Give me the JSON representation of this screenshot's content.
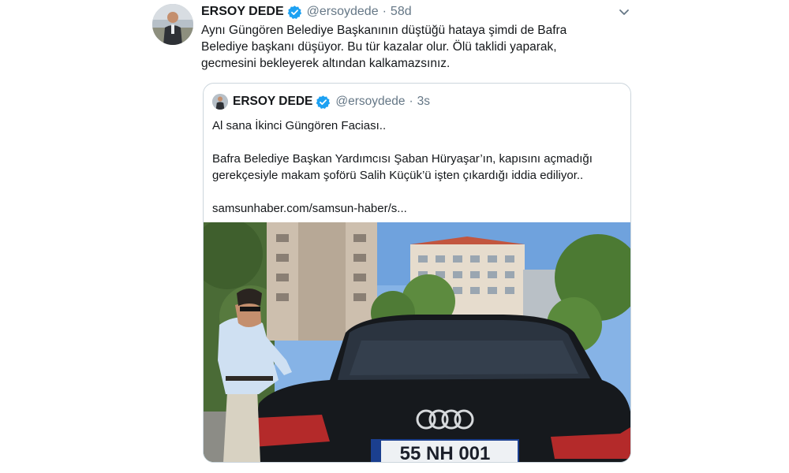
{
  "tweet": {
    "author_name": "ERSOY DEDE",
    "handle": "@ersoydede",
    "separator": "·",
    "time": "58d",
    "text_lines": [
      "Aynı Güngören Belediye Başkanının düştüğü hataya şimdi de Bafra",
      "Belediye başkanı düşüyor. Bu tür kazalar olur. Ölü taklidi yaparak,",
      "gecmesini bekleyerek altından kalkamazsınız."
    ]
  },
  "quote": {
    "author_name": "ERSOY DEDE",
    "handle": "@ersoydede",
    "separator": "·",
    "time": "3s",
    "line1": "Al sana İkinci Güngören Faciası..",
    "line2": "Bafra Belediye Başkan Yardımcısı Şaban Hüryaşar’ın, kapısını açmadığı",
    "line3": "gerekçesiyle makam şoförü Salih Küçük’ü işten çıkardığı iddia ediliyor..",
    "link": "samsunhaber.com/samsun-haber/s...",
    "image": {
      "plate_text": "55 NH 001"
    }
  },
  "colors": {
    "text": "#14171a",
    "secondary": "#657786",
    "verified": "#1da1f2",
    "border": "#ccd6dd"
  },
  "icons": {
    "verified": "verified-badge-icon",
    "caret": "chevron-down-icon"
  }
}
